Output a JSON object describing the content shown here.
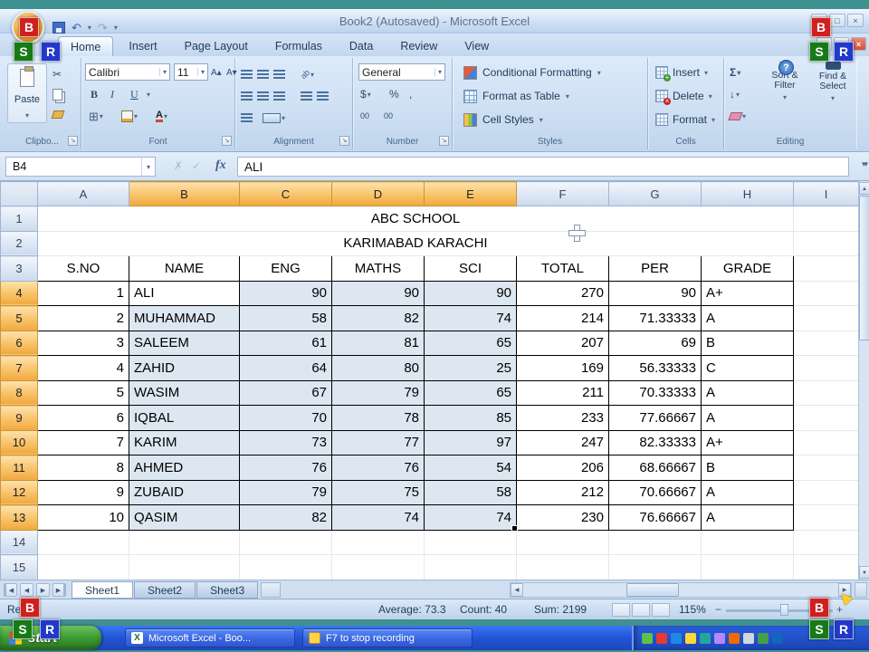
{
  "titlebar": {
    "title": "Book2 (Autosaved) - Microsoft Excel"
  },
  "overlay": {
    "b": "B",
    "s": "S",
    "r": "R"
  },
  "ribbon": {
    "tabs": [
      {
        "label": "Home",
        "active": true
      },
      {
        "label": "Insert"
      },
      {
        "label": "Page Layout"
      },
      {
        "label": "Formulas"
      },
      {
        "label": "Data"
      },
      {
        "label": "Review"
      },
      {
        "label": "View"
      }
    ],
    "clipboard": {
      "paste": "Paste",
      "label": "Clipbo..."
    },
    "font": {
      "family": "Calibri",
      "size": "11",
      "bold": "B",
      "italic": "I",
      "underline": "U",
      "label": "Font"
    },
    "alignment": {
      "label": "Alignment"
    },
    "number": {
      "format": "General",
      "label": "Number"
    },
    "styles": {
      "buttons": [
        "Conditional Formatting",
        "Format as Table",
        "Cell Styles"
      ],
      "label": "Styles"
    },
    "cells": {
      "buttons": [
        "Insert",
        "Delete",
        "Format"
      ],
      "label": "Cells"
    },
    "editing": {
      "sort": "Sort & Filter",
      "find": "Find & Select",
      "label": "Editing"
    }
  },
  "formula_bar": {
    "name_box": "B4",
    "fx": "fx",
    "value": "ALI"
  },
  "grid": {
    "columns": [
      "A",
      "B",
      "C",
      "D",
      "E",
      "F",
      "G",
      "H",
      "I"
    ],
    "selected_columns": [
      "B",
      "C",
      "D",
      "E"
    ],
    "selected_rows": [
      4,
      5,
      6,
      7,
      8,
      9,
      10,
      11,
      12,
      13
    ],
    "row_count": 15,
    "title1": "ABC SCHOOL",
    "title2": "KARIMABAD KARACHI",
    "headers": [
      "S.NO",
      "NAME",
      "ENG",
      "MATHS",
      "SCI",
      "TOTAL",
      "PER",
      "GRADE"
    ],
    "students": [
      [
        "1",
        "ALI",
        "90",
        "90",
        "90",
        "270",
        "90",
        "A+"
      ],
      [
        "2",
        "MUHAMMAD",
        "58",
        "82",
        "74",
        "214",
        "71.33333",
        "A"
      ],
      [
        "3",
        "SALEEM",
        "61",
        "81",
        "65",
        "207",
        "69",
        "B"
      ],
      [
        "4",
        "ZAHID",
        "64",
        "80",
        "25",
        "169",
        "56.33333",
        "C"
      ],
      [
        "5",
        "WASIM",
        "67",
        "79",
        "65",
        "211",
        "70.33333",
        "A"
      ],
      [
        "6",
        "IQBAL",
        "70",
        "78",
        "85",
        "233",
        "77.66667",
        "A"
      ],
      [
        "7",
        "KARIM",
        "73",
        "77",
        "97",
        "247",
        "82.33333",
        "A+"
      ],
      [
        "8",
        "AHMED",
        "76",
        "76",
        "54",
        "206",
        "68.66667",
        "B"
      ],
      [
        "9",
        "ZUBAID",
        "79",
        "75",
        "58",
        "212",
        "70.66667",
        "A"
      ],
      [
        "10",
        "QASIM",
        "82",
        "74",
        "74",
        "230",
        "76.66667",
        "A"
      ]
    ]
  },
  "sheet_bar": {
    "tabs": [
      {
        "label": "Sheet1",
        "active": true
      },
      {
        "label": "Sheet2"
      },
      {
        "label": "Sheet3"
      }
    ]
  },
  "status_bar": {
    "mode": "Ready",
    "average": "Average: 73.3",
    "count": "Count: 40",
    "sum": "Sum: 2199",
    "zoom": "115%"
  },
  "taskbar": {
    "start": "start",
    "windows": [
      {
        "label": "Microsoft Excel - Boo..."
      },
      {
        "label": "F7 to stop recording"
      }
    ]
  },
  "icons": {
    "chevron_down": "▾",
    "undo": "↶",
    "redo": "↷",
    "cut": "✂",
    "sum": "Σ",
    "fill_down": "↓",
    "dollar": "$",
    "percent": "%",
    "comma": ",",
    "zeros": "00",
    "grow_font": "A▴",
    "shrink_font": "A▾",
    "border_grid": "⊞",
    "font_color": "A",
    "orientation": "ab",
    "help": "?",
    "up": "▲",
    "down": "▼",
    "left": "◀",
    "right": "▶",
    "min": "—",
    "restore": "□",
    "close": "×",
    "cancel": "✗",
    "enter": "✓",
    "expand": "▾▾",
    "excel": "X",
    "launcher": "↘",
    "arrow": "▲"
  }
}
